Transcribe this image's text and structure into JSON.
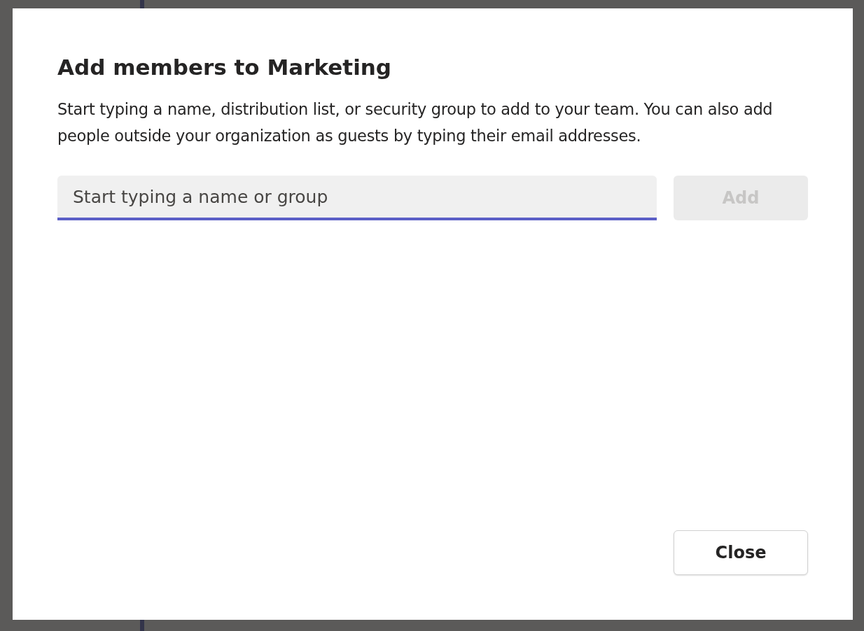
{
  "dialog": {
    "title": "Add members to Marketing",
    "description": "Start typing a name, distribution list, or security group to add to your team. You can also add people outside your organization as guests by typing their email addresses.",
    "search": {
      "placeholder": "Start typing a name or group",
      "focused": true
    },
    "add_button": {
      "label": "Add",
      "disabled": true
    },
    "close_button": {
      "label": "Close",
      "disabled": false
    }
  }
}
